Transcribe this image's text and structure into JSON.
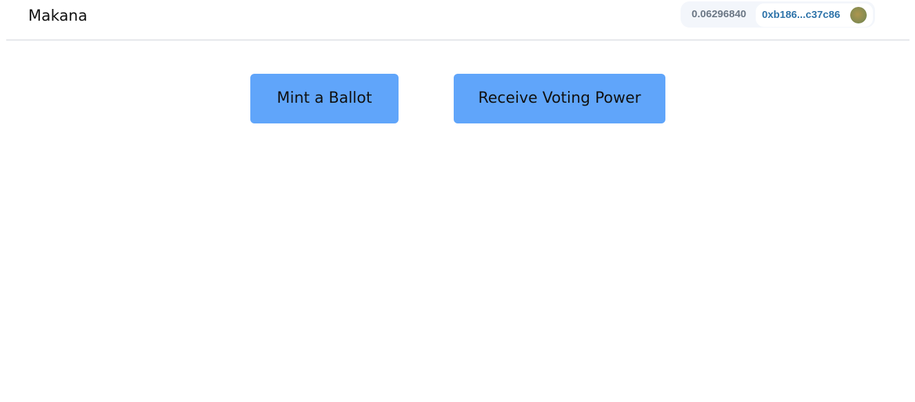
{
  "header": {
    "brand": "Makana",
    "wallet": {
      "balance": "0.06296840",
      "address": "0xb186...c37c86",
      "avatar_icon": "account-identicon"
    }
  },
  "main": {
    "actions": {
      "mint_label": "Mint a Ballot",
      "receive_label": "Receive Voting Power"
    }
  },
  "colors": {
    "button": "#60a5fa",
    "wallet_bg": "#f3f6fb",
    "address": "#2f74aa",
    "balance": "#6b7785",
    "divider": "#e5e7eb"
  }
}
